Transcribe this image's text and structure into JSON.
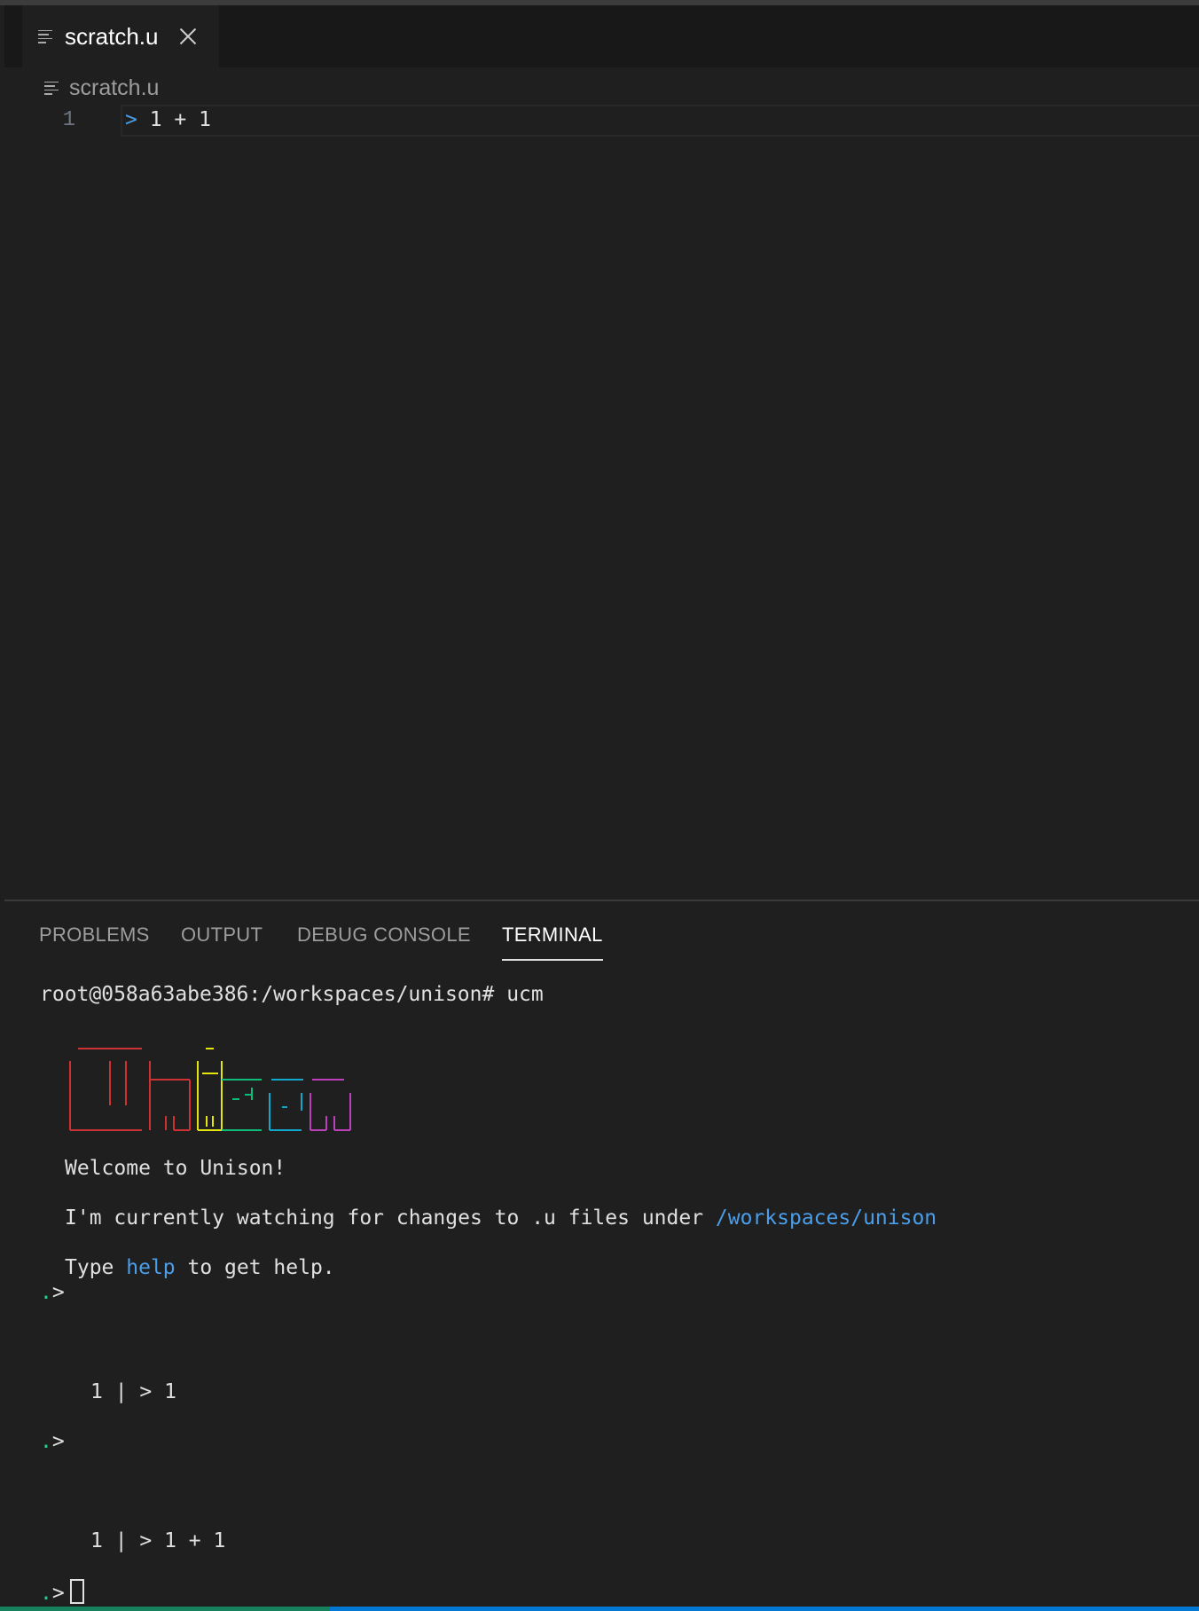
{
  "editor": {
    "tab": {
      "icon": "file-lines-icon",
      "label": "scratch.u"
    },
    "breadcrumb": {
      "icon": "file-lines-icon",
      "label": "scratch.u"
    },
    "lines": [
      {
        "number": "1",
        "prompt": ">",
        "code": " 1 + 1"
      }
    ]
  },
  "panel": {
    "tabs": [
      "PROBLEMS",
      "OUTPUT",
      "DEBUG CONSOLE",
      "TERMINAL"
    ],
    "active_tab": "TERMINAL"
  },
  "terminal": {
    "command_line": "root@058a63abe386:/workspaces/unison# ucm",
    "welcome": "Welcome to Unison!",
    "watching_prefix": "I'm currently watching for changes to .u files under ",
    "watching_path": "/workspaces/unison",
    "help_prefix": "Type ",
    "help_word": "help",
    "help_suffix": " to get help.",
    "prompt_dot": ".",
    "prompt_arrow": ">",
    "result_1": "1 | > 1",
    "result_2": "1 | > 1 + 1",
    "logo_colors": [
      "#cd3131",
      "#e5e510",
      "#0dbc79",
      "#11a8cd",
      "#bc3fbc"
    ]
  },
  "colors": {
    "accent_blue": "#4a9eea",
    "prompt_green": "#23d18b",
    "status_blue": "#0078d4"
  }
}
